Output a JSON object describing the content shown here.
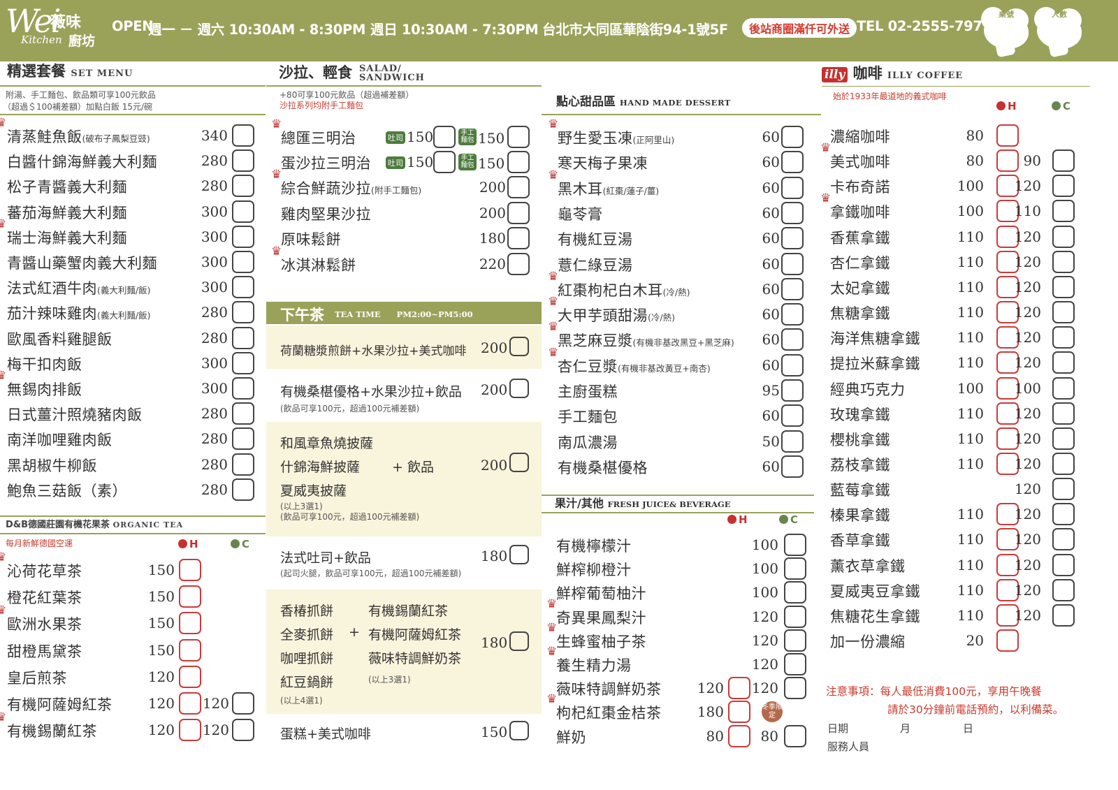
{
  "header": {
    "logo_wei": "Wei",
    "logo_cn": "薇味",
    "logo_kitchen": "Kitchen",
    "logo_kitchen_cn": "廚坊",
    "open_label": "OPEN",
    "hours_weekday": "週一 － 週六 10:30AM - 8:30PM",
    "hours_sunday": "週日 10:30AM - 7:30PM",
    "address": "台北市大同區華陰街94-1號5F",
    "delivery_badge": "後站商圈滿仟可外送",
    "tel": "TEL 02-2555-7977",
    "table_no_label": "桌號",
    "guests_label": "人數"
  },
  "set_menu": {
    "title_cn": "精選套餐",
    "title_en": "SET MENU",
    "note1": "附湯、手工麵包、飲品類可享100元飲品",
    "note2": "（超過＄100補差額）加點白飯 15元/碗",
    "items": [
      {
        "name": "清蒸鮭魚飯",
        "sub": "(破布子鳳梨豆豉)",
        "price": "340",
        "crown": true
      },
      {
        "name": "白醬什錦海鮮義大利麵",
        "sub": "",
        "price": "280",
        "crown": false
      },
      {
        "name": "松子青醬義大利麵",
        "sub": "",
        "price": "280",
        "crown": false
      },
      {
        "name": "蕃茄海鮮義大利麵",
        "sub": "",
        "price": "300",
        "crown": false
      },
      {
        "name": "瑞士海鮮義大利麵",
        "sub": "",
        "price": "300",
        "crown": true
      },
      {
        "name": "青醬山藥蟹肉義大利麵",
        "sub": "",
        "price": "300",
        "crown": false
      },
      {
        "name": "法式紅酒牛肉",
        "sub": "(義大利麵/飯)",
        "price": "300",
        "crown": false
      },
      {
        "name": "茄汁辣味雞肉",
        "sub": "(義大利麵/飯)",
        "price": "280",
        "crown": false
      },
      {
        "name": "歐風香料雞腿飯",
        "sub": "",
        "price": "280",
        "crown": false
      },
      {
        "name": "梅干扣肉飯",
        "sub": "",
        "price": "300",
        "crown": false
      },
      {
        "name": "無錫肉排飯",
        "sub": "",
        "price": "300",
        "crown": true
      },
      {
        "name": "日式薑汁照燒豬肉飯",
        "sub": "",
        "price": "280",
        "crown": false
      },
      {
        "name": "南洋咖哩雞肉飯",
        "sub": "",
        "price": "280",
        "crown": false
      },
      {
        "name": "黑胡椒牛柳飯",
        "sub": "",
        "price": "280",
        "crown": false
      },
      {
        "name": "鮑魚三菇飯（素）",
        "sub": "",
        "price": "280",
        "crown": false
      }
    ]
  },
  "tea": {
    "title": "D&B德國莊園有機花果茶",
    "title_en": "ORGANIC TEA",
    "note": "每月新鮮德國空運",
    "h_label": "H",
    "c_label": "C",
    "items": [
      {
        "name": "沁荷花草茶",
        "h": "150",
        "c": "",
        "crown": true
      },
      {
        "name": "橙花紅葉茶",
        "h": "150",
        "c": "",
        "crown": false
      },
      {
        "name": "歐洲水果茶",
        "h": "150",
        "c": "",
        "crown": true
      },
      {
        "name": "甜橙馬黛茶",
        "h": "150",
        "c": "",
        "crown": false
      },
      {
        "name": "皇后煎茶",
        "h": "120",
        "c": "",
        "crown": false
      },
      {
        "name": "有機阿薩姆紅茶",
        "h": "120",
        "c": "120",
        "crown": false
      },
      {
        "name": "有機錫蘭紅茶",
        "h": "120",
        "c": "120",
        "crown": true
      }
    ]
  },
  "salad": {
    "title_cn": "沙拉、輕食",
    "title_en1": "SALAD/",
    "title_en2": "SANDWICH",
    "note1": "+80可享100元飲品（超過補差額）",
    "note2": "沙拉系列均附手工麵包",
    "sandwiches": [
      {
        "name": "總匯三明治",
        "toast_label": "吐司",
        "price_toast": "150",
        "bread_label": "手工麵包",
        "price_bread": "150",
        "crown": true
      },
      {
        "name": "蛋沙拉三明治",
        "toast_label": "吐司",
        "price_toast": "150",
        "bread_label": "手工麵包",
        "price_bread": "150",
        "crown": false
      }
    ],
    "items": [
      {
        "name": "綜合鮮蔬沙拉",
        "sub": "(附手工麵包)",
        "price": "200",
        "crown": true
      },
      {
        "name": "雞肉堅果沙拉",
        "sub": "",
        "price": "200",
        "crown": false
      },
      {
        "name": "原味鬆餅",
        "sub": "",
        "price": "180",
        "crown": false
      },
      {
        "name": "冰淇淋鬆餅",
        "sub": "",
        "price": "220",
        "crown": true
      }
    ]
  },
  "teatime": {
    "title": "下午茶",
    "title_en": "TEA TIME　　PM2:00~PM5:00",
    "set1": {
      "text": "荷蘭糖漿煎餅+水果沙拉+美式咖啡",
      "price": "200"
    },
    "set2": {
      "text": "有機桑椹優格+水果沙拉+飲品",
      "price": "200",
      "note": "(飲品可享100元，超過100元補差額)"
    },
    "set3": {
      "opt1": "和風章魚燒披薩",
      "opt2": "什錦海鮮披薩",
      "opt3": "夏威夷披薩",
      "plus": "+ 飲品",
      "price": "200",
      "note1": "(以上3選1)",
      "note2": "(飲品可享100元，超過100元補差額)"
    },
    "set4": {
      "text": "法式吐司+飲品",
      "price": "180",
      "note": "(起司火腿，飲品可享100元，超過100元補差額)"
    },
    "set5": {
      "a1": "香椿抓餅",
      "a2": "全麥抓餅",
      "a3": "咖哩抓餅",
      "a4": "紅豆鍋餅",
      "plus": "+",
      "b1": "有機錫蘭紅茶",
      "b2": "有機阿薩姆紅茶",
      "b3": "薇味特調鮮奶茶",
      "price": "180",
      "note_a": "(以上4選1)",
      "note_b": "(以上3選1)"
    },
    "set6": {
      "text": "蛋糕+美式咖啡",
      "price": "150"
    }
  },
  "dessert": {
    "title_cn": "點心甜品區",
    "title_en": "HAND MADE DESSERT",
    "items": [
      {
        "name": "野生愛玉凍",
        "sub": "(正阿里山)",
        "price": "60",
        "crown": true
      },
      {
        "name": "寒天梅子果凍",
        "sub": "",
        "price": "60",
        "crown": false
      },
      {
        "name": "黑木耳",
        "sub": "(紅棗/蓮子/薑)",
        "price": "60",
        "crown": true
      },
      {
        "name": "龜苓膏",
        "sub": "",
        "price": "60",
        "crown": false
      },
      {
        "name": "有機紅豆湯",
        "sub": "",
        "price": "60",
        "crown": false
      },
      {
        "name": "薏仁綠豆湯",
        "sub": "",
        "price": "60",
        "crown": false
      },
      {
        "name": "紅棗枸杞白木耳",
        "sub": "(冷/熱)",
        "price": "60",
        "crown": true
      },
      {
        "name": "大甲芋頭甜湯",
        "sub": "(冷/熱)",
        "price": "60",
        "crown": true
      },
      {
        "name": "黑芝麻豆漿",
        "sub": "(有機非基改黑豆+黑芝麻)",
        "price": "60",
        "crown": true
      },
      {
        "name": "杏仁豆漿",
        "sub": "(有機非基改黃豆+南杏)",
        "price": "60",
        "crown": true
      },
      {
        "name": "主廚蛋糕",
        "sub": "",
        "price": "95",
        "crown": false
      },
      {
        "name": "手工麵包",
        "sub": "",
        "price": "60",
        "crown": false
      },
      {
        "name": "南瓜濃湯",
        "sub": "",
        "price": "50",
        "crown": false
      },
      {
        "name": "有機桑椹優格",
        "sub": "",
        "price": "60",
        "crown": false
      }
    ]
  },
  "juice": {
    "title_cn": "果汁/其他",
    "title_en": "FRESH JUICE& BEVERAGE",
    "h_label": "H",
    "c_label": "C",
    "winter_label": "冬季限定",
    "items": [
      {
        "name": "有機檸檬汁",
        "h": "",
        "c": "100",
        "crown": false
      },
      {
        "name": "鮮榨柳橙汁",
        "h": "",
        "c": "100",
        "crown": false
      },
      {
        "name": "鮮榨葡萄柚汁",
        "h": "",
        "c": "100",
        "crown": false
      },
      {
        "name": "奇異果鳳梨汁",
        "h": "",
        "c": "120",
        "crown": true
      },
      {
        "name": "生蜂蜜柚子茶",
        "h": "",
        "c": "120",
        "crown": true
      },
      {
        "name": "養生精力湯",
        "h": "",
        "c": "120",
        "crown": true
      },
      {
        "name": "薇味特調鮮奶茶",
        "h": "120",
        "c": "120",
        "crown": false
      },
      {
        "name": "枸杞紅棗金桔茶",
        "h": "180",
        "c": "",
        "crown": true
      },
      {
        "name": "鮮奶",
        "h": "80",
        "c": "80",
        "crown": false
      }
    ]
  },
  "coffee": {
    "brand": "illy",
    "title_cn": "咖啡",
    "title_en": "ILLY COFFEE",
    "note": "始於1933年最道地的義式咖啡",
    "h_label": "H",
    "c_label": "C",
    "items": [
      {
        "name": "濃縮咖啡",
        "h": "80",
        "c": "",
        "crown": false
      },
      {
        "name": "美式咖啡",
        "h": "80",
        "c": "90",
        "crown": true
      },
      {
        "name": "卡布奇諾",
        "h": "100",
        "c": "120",
        "crown": false
      },
      {
        "name": "拿鐵咖啡",
        "h": "100",
        "c": "110",
        "crown": true
      },
      {
        "name": "香蕉拿鐵",
        "h": "110",
        "c": "120",
        "crown": false
      },
      {
        "name": "杏仁拿鐵",
        "h": "110",
        "c": "120",
        "crown": false
      },
      {
        "name": "太妃拿鐵",
        "h": "110",
        "c": "120",
        "crown": false
      },
      {
        "name": "焦糖拿鐵",
        "h": "110",
        "c": "120",
        "crown": false
      },
      {
        "name": "海洋焦糖拿鐵",
        "h": "110",
        "c": "120",
        "crown": false
      },
      {
        "name": "提拉米蘇拿鐵",
        "h": "110",
        "c": "120",
        "crown": false
      },
      {
        "name": "經典巧克力",
        "h": "100",
        "c": "100",
        "crown": false
      },
      {
        "name": "玫瑰拿鐵",
        "h": "110",
        "c": "120",
        "crown": false
      },
      {
        "name": "櫻桃拿鐵",
        "h": "110",
        "c": "120",
        "crown": false
      },
      {
        "name": "荔枝拿鐵",
        "h": "110",
        "c": "120",
        "crown": false
      },
      {
        "name": "藍莓拿鐵",
        "h": "",
        "c": "120",
        "crown": false
      },
      {
        "name": "榛果拿鐵",
        "h": "110",
        "c": "120",
        "crown": false
      },
      {
        "name": "香草拿鐵",
        "h": "110",
        "c": "120",
        "crown": false
      },
      {
        "name": "薰衣草拿鐵",
        "h": "110",
        "c": "120",
        "crown": false
      },
      {
        "name": "夏威夷豆拿鐵",
        "h": "110",
        "c": "120",
        "crown": false
      },
      {
        "name": "焦糖花生拿鐵",
        "h": "110",
        "c": "120",
        "crown": false
      },
      {
        "name": "加一份濃縮",
        "h": "20",
        "c": "",
        "crown": false
      }
    ],
    "notice1": "注意事項：每人最低消費100元，享用午晚餐",
    "notice2": "請於30分鐘前電話預約，以利備菜。",
    "date_label": "日期",
    "month_label": "月",
    "day_label": "日",
    "staff_label": "服務人員"
  }
}
